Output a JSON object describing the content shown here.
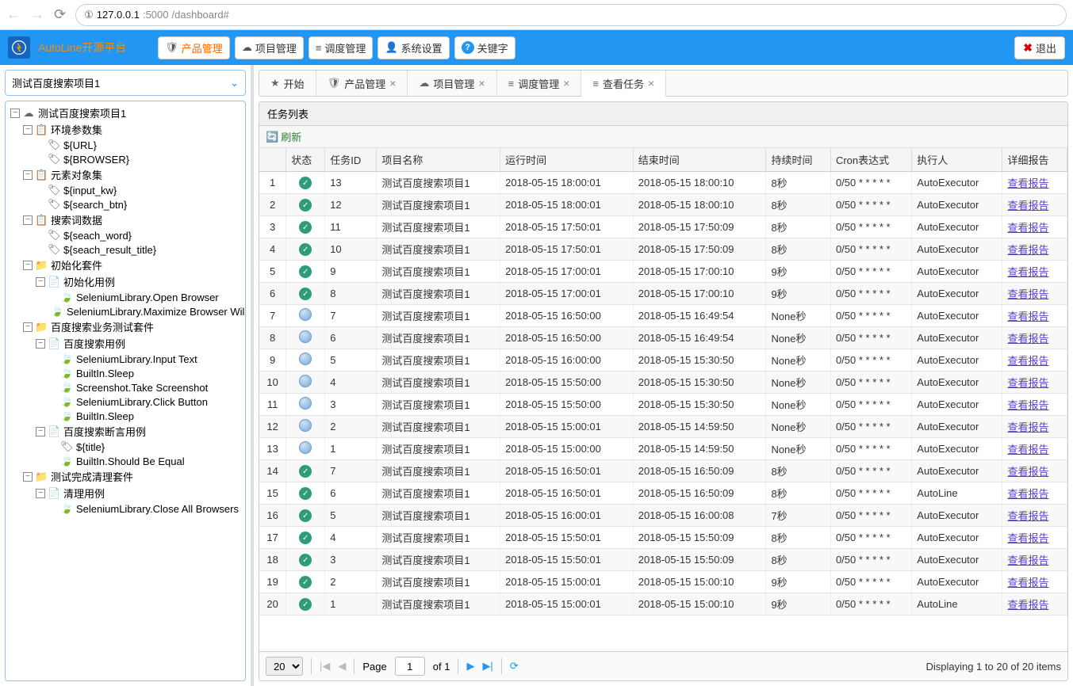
{
  "browser": {
    "url_proto": "①",
    "url_host": "127.0.0.1",
    "url_port": ":5000",
    "url_path": "/dashboard#"
  },
  "brand": "AutoLine开源平台",
  "topButtons": [
    {
      "icon": "🛡",
      "label": "产品管理"
    },
    {
      "icon": "☁",
      "label": "项目管理"
    },
    {
      "icon": "≡",
      "label": "调度管理"
    },
    {
      "icon": "👤",
      "label": "系统设置"
    },
    {
      "icon": "?",
      "label": "关键字"
    }
  ],
  "exit": "退出",
  "projectSelect": "测试百度搜索项目1",
  "tree": [
    {
      "l": 0,
      "t": "−",
      "i": "☁",
      "label": "测试百度搜索项目1"
    },
    {
      "l": 1,
      "t": "−",
      "i": "📋",
      "label": "环境参数集"
    },
    {
      "l": 2,
      "t": "",
      "i": "🏷",
      "label": "${URL}"
    },
    {
      "l": 2,
      "t": "",
      "i": "🏷",
      "label": "${BROWSER}"
    },
    {
      "l": 1,
      "t": "−",
      "i": "📋",
      "label": "元素对象集"
    },
    {
      "l": 2,
      "t": "",
      "i": "🏷",
      "label": "${input_kw}"
    },
    {
      "l": 2,
      "t": "",
      "i": "🏷",
      "label": "${search_btn}"
    },
    {
      "l": 1,
      "t": "−",
      "i": "📋",
      "label": "搜索词数据"
    },
    {
      "l": 2,
      "t": "",
      "i": "🏷",
      "label": "${seach_word}"
    },
    {
      "l": 2,
      "t": "",
      "i": "🏷",
      "label": "${seach_result_title}"
    },
    {
      "l": 1,
      "t": "−",
      "i": "📁",
      "label": "初始化套件"
    },
    {
      "l": 2,
      "t": "−",
      "i": "📄",
      "label": "初始化用例"
    },
    {
      "l": 3,
      "t": "",
      "i": "🍃",
      "label": "SeleniumLibrary.Open Browser"
    },
    {
      "l": 3,
      "t": "",
      "i": "🍃",
      "label": "SeleniumLibrary.Maximize Browser Wil"
    },
    {
      "l": 1,
      "t": "−",
      "i": "📁",
      "label": "百度搜索业务测试套件"
    },
    {
      "l": 2,
      "t": "−",
      "i": "📄",
      "label": "百度搜索用例"
    },
    {
      "l": 3,
      "t": "",
      "i": "🍃",
      "label": "SeleniumLibrary.Input Text"
    },
    {
      "l": 3,
      "t": "",
      "i": "🍃",
      "label": "BuiltIn.Sleep"
    },
    {
      "l": 3,
      "t": "",
      "i": "🍃",
      "label": "Screenshot.Take Screenshot"
    },
    {
      "l": 3,
      "t": "",
      "i": "🍃",
      "label": "SeleniumLibrary.Click Button"
    },
    {
      "l": 3,
      "t": "",
      "i": "🍃",
      "label": "BuiltIn.Sleep"
    },
    {
      "l": 2,
      "t": "−",
      "i": "📄",
      "label": "百度搜索断言用例"
    },
    {
      "l": 3,
      "t": "",
      "i": "🏷",
      "label": "${title}"
    },
    {
      "l": 3,
      "t": "",
      "i": "🍃",
      "label": "BuiltIn.Should Be Equal"
    },
    {
      "l": 1,
      "t": "−",
      "i": "📁",
      "label": "测试完成清理套件"
    },
    {
      "l": 2,
      "t": "−",
      "i": "📄",
      "label": "清理用例"
    },
    {
      "l": 3,
      "t": "",
      "i": "🍃",
      "label": "SeleniumLibrary.Close All Browsers"
    }
  ],
  "tabs": [
    {
      "icon": "★",
      "label": "开始",
      "close": false
    },
    {
      "icon": "🛡",
      "label": "产品管理",
      "close": true
    },
    {
      "icon": "☁",
      "label": "项目管理",
      "close": true
    },
    {
      "icon": "≡",
      "label": "调度管理",
      "close": true
    },
    {
      "icon": "≡",
      "label": "查看任务",
      "close": true,
      "active": true
    }
  ],
  "panelTitle": "任务列表",
  "refreshLabel": "刷新",
  "columns": [
    "",
    "状态",
    "任务ID",
    "项目名称",
    "运行时间",
    "结束时间",
    "持续时间",
    "Cron表达式",
    "执行人",
    "详细报告"
  ],
  "reportLink": "查看报告",
  "rows": [
    {
      "n": 1,
      "s": "ok",
      "id": 13,
      "name": "测试百度搜索项目1",
      "start": "2018-05-15 18:00:01",
      "end": "2018-05-15 18:00:10",
      "dur": "8秒",
      "cron": "0/50 * * * * *",
      "exec": "AutoExecutor"
    },
    {
      "n": 2,
      "s": "ok",
      "id": 12,
      "name": "测试百度搜索项目1",
      "start": "2018-05-15 18:00:01",
      "end": "2018-05-15 18:00:10",
      "dur": "8秒",
      "cron": "0/50 * * * * *",
      "exec": "AutoExecutor"
    },
    {
      "n": 3,
      "s": "ok",
      "id": 11,
      "name": "测试百度搜索项目1",
      "start": "2018-05-15 17:50:01",
      "end": "2018-05-15 17:50:09",
      "dur": "8秒",
      "cron": "0/50 * * * * *",
      "exec": "AutoExecutor"
    },
    {
      "n": 4,
      "s": "ok",
      "id": 10,
      "name": "测试百度搜索项目1",
      "start": "2018-05-15 17:50:01",
      "end": "2018-05-15 17:50:09",
      "dur": "8秒",
      "cron": "0/50 * * * * *",
      "exec": "AutoExecutor"
    },
    {
      "n": 5,
      "s": "ok",
      "id": 9,
      "name": "测试百度搜索项目1",
      "start": "2018-05-15 17:00:01",
      "end": "2018-05-15 17:00:10",
      "dur": "9秒",
      "cron": "0/50 * * * * *",
      "exec": "AutoExecutor"
    },
    {
      "n": 6,
      "s": "ok",
      "id": 8,
      "name": "测试百度搜索项目1",
      "start": "2018-05-15 17:00:01",
      "end": "2018-05-15 17:00:10",
      "dur": "9秒",
      "cron": "0/50 * * * * *",
      "exec": "AutoExecutor"
    },
    {
      "n": 7,
      "s": "unk",
      "id": 7,
      "name": "测试百度搜索项目1",
      "start": "2018-05-15 16:50:00",
      "end": "2018-05-15 16:49:54",
      "dur": "None秒",
      "cron": "0/50 * * * * *",
      "exec": "AutoExecutor"
    },
    {
      "n": 8,
      "s": "unk",
      "id": 6,
      "name": "测试百度搜索项目1",
      "start": "2018-05-15 16:50:00",
      "end": "2018-05-15 16:49:54",
      "dur": "None秒",
      "cron": "0/50 * * * * *",
      "exec": "AutoExecutor"
    },
    {
      "n": 9,
      "s": "unk",
      "id": 5,
      "name": "测试百度搜索项目1",
      "start": "2018-05-15 16:00:00",
      "end": "2018-05-15 15:30:50",
      "dur": "None秒",
      "cron": "0/50 * * * * *",
      "exec": "AutoExecutor"
    },
    {
      "n": 10,
      "s": "unk",
      "id": 4,
      "name": "测试百度搜索项目1",
      "start": "2018-05-15 15:50:00",
      "end": "2018-05-15 15:30:50",
      "dur": "None秒",
      "cron": "0/50 * * * * *",
      "exec": "AutoExecutor"
    },
    {
      "n": 11,
      "s": "unk",
      "id": 3,
      "name": "测试百度搜索项目1",
      "start": "2018-05-15 15:50:00",
      "end": "2018-05-15 15:30:50",
      "dur": "None秒",
      "cron": "0/50 * * * * *",
      "exec": "AutoExecutor"
    },
    {
      "n": 12,
      "s": "unk",
      "id": 2,
      "name": "测试百度搜索项目1",
      "start": "2018-05-15 15:00:01",
      "end": "2018-05-15 14:59:50",
      "dur": "None秒",
      "cron": "0/50 * * * * *",
      "exec": "AutoExecutor"
    },
    {
      "n": 13,
      "s": "unk",
      "id": 1,
      "name": "测试百度搜索项目1",
      "start": "2018-05-15 15:00:00",
      "end": "2018-05-15 14:59:50",
      "dur": "None秒",
      "cron": "0/50 * * * * *",
      "exec": "AutoExecutor"
    },
    {
      "n": 14,
      "s": "ok",
      "id": 7,
      "name": "测试百度搜索项目1",
      "start": "2018-05-15 16:50:01",
      "end": "2018-05-15 16:50:09",
      "dur": "8秒",
      "cron": "0/50 * * * * *",
      "exec": "AutoExecutor"
    },
    {
      "n": 15,
      "s": "ok",
      "id": 6,
      "name": "测试百度搜索项目1",
      "start": "2018-05-15 16:50:01",
      "end": "2018-05-15 16:50:09",
      "dur": "8秒",
      "cron": "0/50 * * * * *",
      "exec": "AutoLine"
    },
    {
      "n": 16,
      "s": "ok",
      "id": 5,
      "name": "测试百度搜索项目1",
      "start": "2018-05-15 16:00:01",
      "end": "2018-05-15 16:00:08",
      "dur": "7秒",
      "cron": "0/50 * * * * *",
      "exec": "AutoExecutor"
    },
    {
      "n": 17,
      "s": "ok",
      "id": 4,
      "name": "测试百度搜索项目1",
      "start": "2018-05-15 15:50:01",
      "end": "2018-05-15 15:50:09",
      "dur": "8秒",
      "cron": "0/50 * * * * *",
      "exec": "AutoExecutor"
    },
    {
      "n": 18,
      "s": "ok",
      "id": 3,
      "name": "测试百度搜索项目1",
      "start": "2018-05-15 15:50:01",
      "end": "2018-05-15 15:50:09",
      "dur": "8秒",
      "cron": "0/50 * * * * *",
      "exec": "AutoExecutor"
    },
    {
      "n": 19,
      "s": "ok",
      "id": 2,
      "name": "测试百度搜索项目1",
      "start": "2018-05-15 15:00:01",
      "end": "2018-05-15 15:00:10",
      "dur": "9秒",
      "cron": "0/50 * * * * *",
      "exec": "AutoExecutor"
    },
    {
      "n": 20,
      "s": "ok",
      "id": 1,
      "name": "测试百度搜索项目1",
      "start": "2018-05-15 15:00:01",
      "end": "2018-05-15 15:00:10",
      "dur": "9秒",
      "cron": "0/50 * * * * *",
      "exec": "AutoLine"
    }
  ],
  "pager": {
    "pageSize": "20",
    "pageLabel": "Page",
    "pageNum": "1",
    "ofLabel": "of 1",
    "info": "Displaying 1 to 20 of 20 items"
  }
}
